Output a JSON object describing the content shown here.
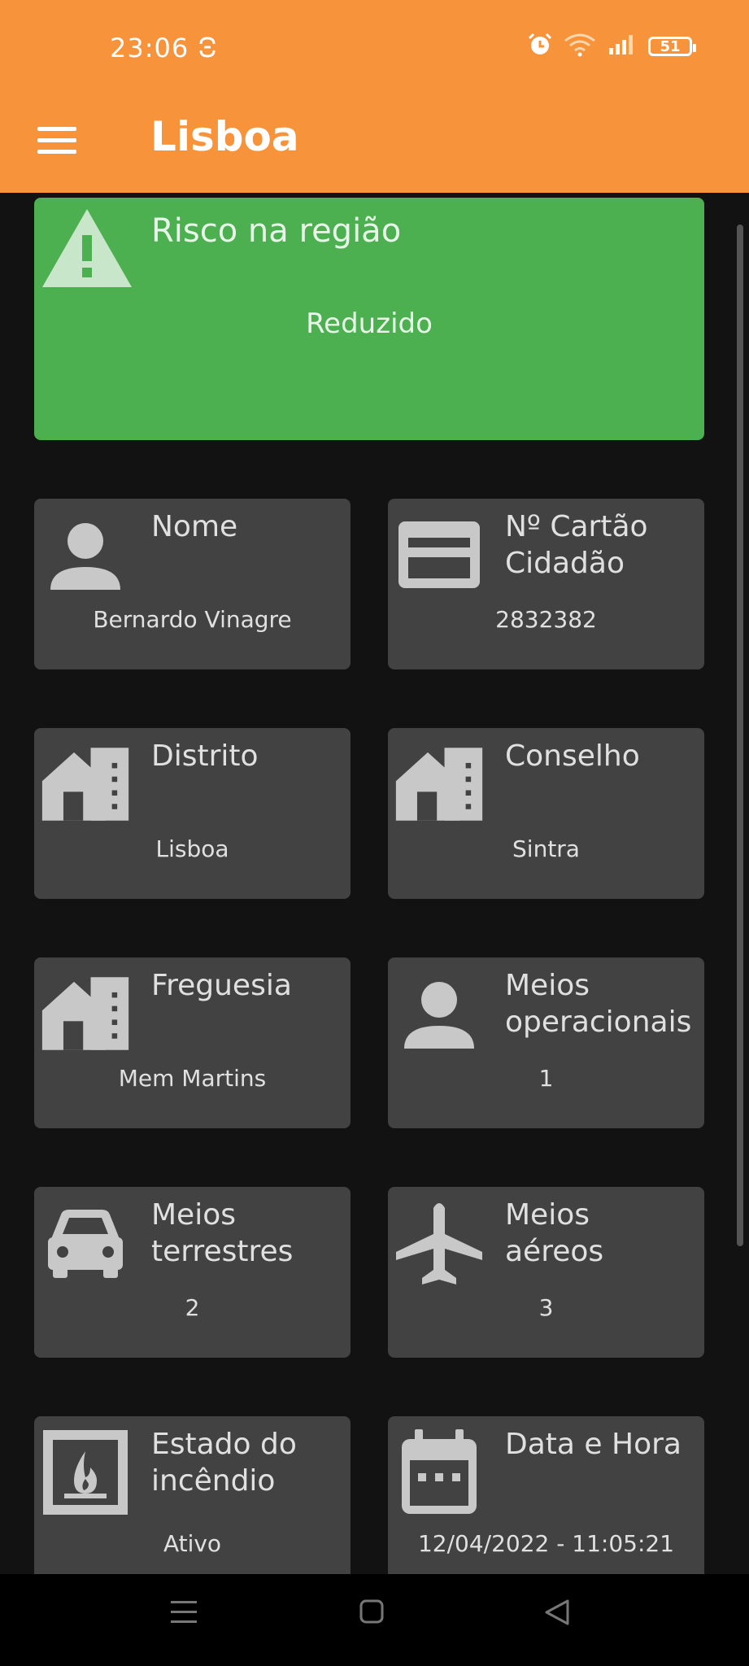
{
  "status_bar": {
    "time": "23:06",
    "battery": "51"
  },
  "app_bar": {
    "title": "Lisboa"
  },
  "risk": {
    "title": "Risco na região",
    "value": "Reduzido"
  },
  "tiles": [
    {
      "title": "Nome",
      "value": "Bernardo Vinagre",
      "icon": "person-icon"
    },
    {
      "title": "Nº Cartão Cidadão",
      "value": "2832382",
      "icon": "id-card-icon"
    },
    {
      "title": "Distrito",
      "value": "Lisboa",
      "icon": "buildings-icon"
    },
    {
      "title": "Conselho",
      "value": "Sintra",
      "icon": "buildings-icon"
    },
    {
      "title": "Freguesia",
      "value": "Mem Martins",
      "icon": "buildings-icon"
    },
    {
      "title": "Meios operacionais",
      "value": "1",
      "icon": "person-icon"
    },
    {
      "title": "Meios terrestres",
      "value": "2",
      "icon": "car-icon"
    },
    {
      "title": "Meios aéreos",
      "value": "3",
      "icon": "airplane-icon"
    },
    {
      "title": "Estado do incêndio",
      "value": "Ativo",
      "icon": "fireplace-icon"
    },
    {
      "title": "Data e Hora",
      "value": "12/04/2022 - 11:05:21",
      "icon": "calendar-icon"
    }
  ],
  "colors": {
    "status_bar": "#F7933A",
    "risk_green": "#4CAF50",
    "tile_bg": "#424242",
    "background": "#121212"
  }
}
